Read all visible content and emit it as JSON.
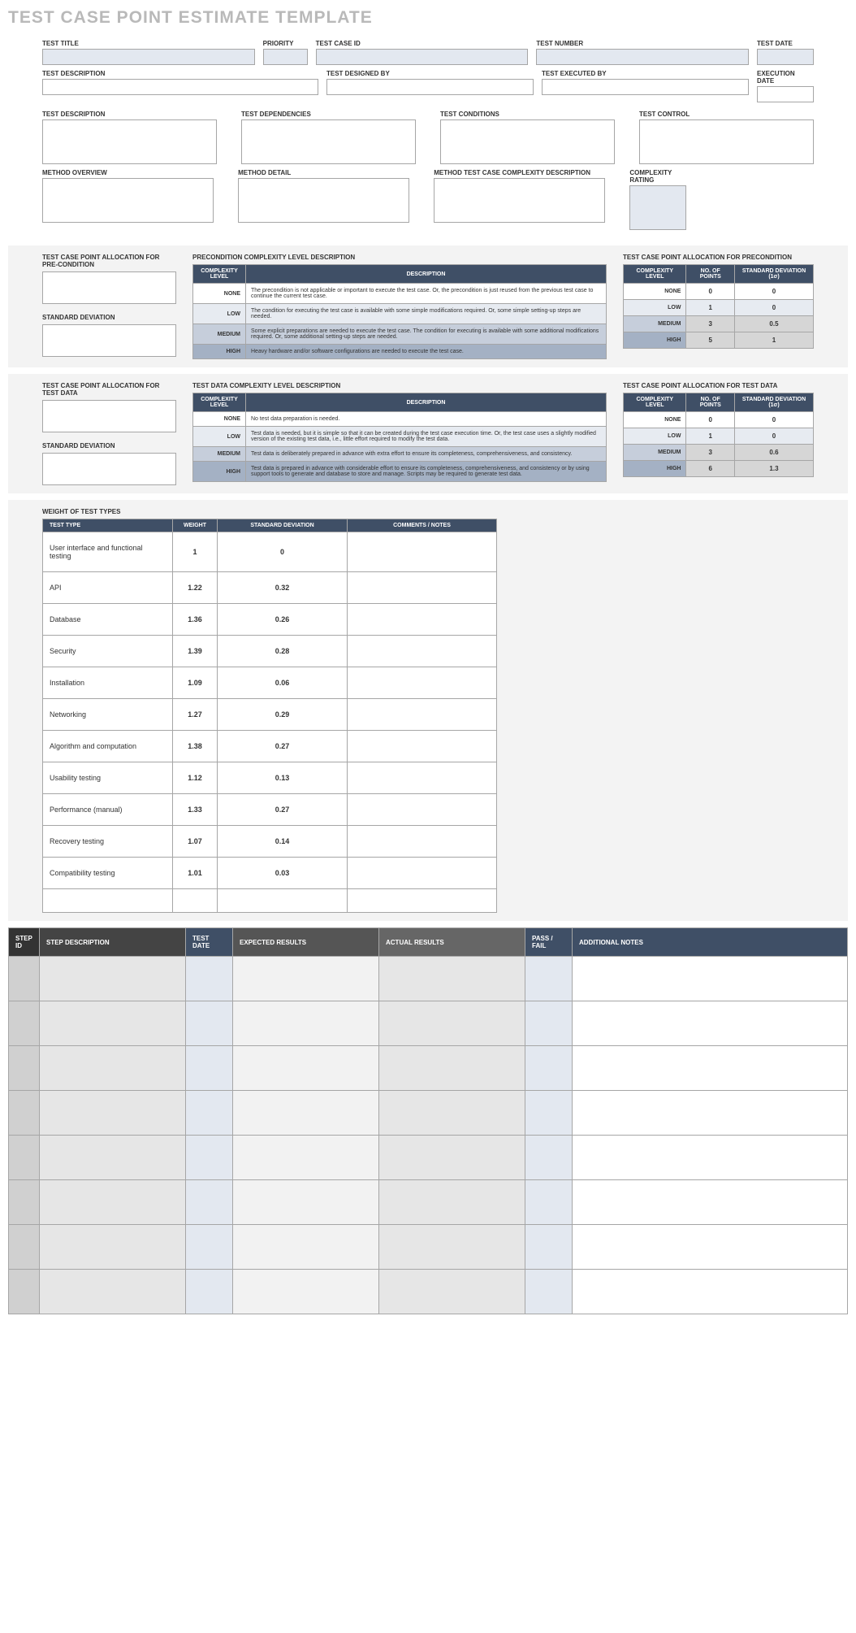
{
  "title": "TEST CASE POINT ESTIMATE TEMPLATE",
  "topRow1": {
    "test_title": "TEST TITLE",
    "priority": "PRIORITY",
    "test_case_id": "TEST CASE ID",
    "test_number": "TEST NUMBER",
    "test_date": "TEST DATE"
  },
  "topRow2": {
    "test_description": "TEST DESCRIPTION",
    "test_designed_by": "TEST DESIGNED BY",
    "test_executed_by": "TEST EXECUTED BY",
    "execution_date": "EXECUTION DATE"
  },
  "metaRow1": {
    "test_description": "TEST DESCRIPTION",
    "test_dependencies": "TEST DEPENDENCIES",
    "test_conditions": "TEST CONDITIONS",
    "test_control": "TEST CONTROL"
  },
  "metaRow2": {
    "method_overview": "METHOD OVERVIEW",
    "method_detail": "METHOD DETAIL",
    "method_complexity_desc": "METHOD TEST CASE COMPLEXITY DESCRIPTION",
    "complexity_rating": "COMPLEXITY RATING"
  },
  "precond": {
    "left_title": "TEST CASE POINT ALLOCATION FOR PRE-CONDITION",
    "std_dev_label": "STANDARD DEVIATION",
    "mid_title": "PRECONDITION COMPLEXITY LEVEL DESCRIPTION",
    "right_title": "TEST CASE POINT ALLOCATION FOR PRECONDITION",
    "headers_mid": {
      "level": "COMPLEXITY LEVEL",
      "desc": "DESCRIPTION"
    },
    "headers_right": {
      "level": "COMPLEXITY LEVEL",
      "points": "NO. OF POINTS",
      "sd": "STANDARD DEVIATION (1σ)"
    },
    "rows": [
      {
        "level": "NONE",
        "desc": "The precondition is not applicable or important to execute the test case. Or, the precondition is just reused from the previous test case to continue the current test case.",
        "points": "0",
        "sd": "0"
      },
      {
        "level": "LOW",
        "desc": "The condition for executing the test case is available with some simple modifications required. Or, some simple setting-up steps are needed.",
        "points": "1",
        "sd": "0"
      },
      {
        "level": "MEDIUM",
        "desc": "Some explicit preparations are needed to execute the test case. The condition for executing is available with some additional modifications required. Or, some additional setting-up steps are needed.",
        "points": "3",
        "sd": "0.5"
      },
      {
        "level": "HIGH",
        "desc": "Heavy hardware and/or software configurations are needed to execute the test case.",
        "points": "5",
        "sd": "1"
      }
    ]
  },
  "testdata": {
    "left_title": "TEST CASE POINT ALLOCATION FOR TEST DATA",
    "std_dev_label": "STANDARD DEVIATION",
    "mid_title": "TEST DATA COMPLEXITY LEVEL DESCRIPTION",
    "right_title": "TEST CASE POINT ALLOCATION FOR TEST DATA",
    "headers_mid": {
      "level": "COMPLEXITY LEVEL",
      "desc": "DESCRIPTION"
    },
    "headers_right": {
      "level": "COMPLEXITY LEVEL",
      "points": "NO. OF POINTS",
      "sd": "STANDARD DEVIATION (1σ)"
    },
    "rows": [
      {
        "level": "NONE",
        "desc": "No test data preparation is needed.",
        "points": "0",
        "sd": "0"
      },
      {
        "level": "LOW",
        "desc": "Test data is needed, but it is simple so that it can be created during the test case execution time. Or, the test case uses a slightly modified version of the existing test data, i.e., little effort required to modify the test data.",
        "points": "1",
        "sd": "0"
      },
      {
        "level": "MEDIUM",
        "desc": "Test data is deliberately prepared in advance with extra effort to ensure its completeness, comprehensiveness, and consistency.",
        "points": "3",
        "sd": "0.6"
      },
      {
        "level": "HIGH",
        "desc": "Test data is prepared in advance with considerable effort to ensure its completeness, comprehensiveness, and consistency or by using support tools to generate and database to store and manage. Scripts may be required to generate test data.",
        "points": "6",
        "sd": "1.3"
      }
    ]
  },
  "weights": {
    "title": "WEIGHT OF TEST TYPES",
    "headers": {
      "type": "TEST TYPE",
      "weight": "WEIGHT",
      "sd": "STANDARD DEVIATION",
      "comments": "COMMENTS / NOTES"
    },
    "rows": [
      {
        "type": "User interface and functional testing",
        "weight": "1",
        "sd": "0",
        "comments": ""
      },
      {
        "type": "API",
        "weight": "1.22",
        "sd": "0.32",
        "comments": ""
      },
      {
        "type": "Database",
        "weight": "1.36",
        "sd": "0.26",
        "comments": ""
      },
      {
        "type": "Security",
        "weight": "1.39",
        "sd": "0.28",
        "comments": ""
      },
      {
        "type": "Installation",
        "weight": "1.09",
        "sd": "0.06",
        "comments": ""
      },
      {
        "type": "Networking",
        "weight": "1.27",
        "sd": "0.29",
        "comments": ""
      },
      {
        "type": "Algorithm and computation",
        "weight": "1.38",
        "sd": "0.27",
        "comments": ""
      },
      {
        "type": "Usability testing",
        "weight": "1.12",
        "sd": "0.13",
        "comments": ""
      },
      {
        "type": "Performance (manual)",
        "weight": "1.33",
        "sd": "0.27",
        "comments": ""
      },
      {
        "type": "Recovery testing",
        "weight": "1.07",
        "sd": "0.14",
        "comments": ""
      },
      {
        "type": "Compatibility testing",
        "weight": "1.01",
        "sd": "0.03",
        "comments": ""
      },
      {
        "type": "",
        "weight": "",
        "sd": "",
        "comments": ""
      }
    ]
  },
  "steps": {
    "headers": {
      "step_id": "STEP ID",
      "step_desc": "STEP DESCRIPTION",
      "test_date": "TEST DATE",
      "expected": "EXPECTED RESULTS",
      "actual": "ACTUAL RESULTS",
      "passfail": "PASS / FAIL",
      "notes": "ADDITIONAL NOTES"
    },
    "rowCount": 8
  }
}
